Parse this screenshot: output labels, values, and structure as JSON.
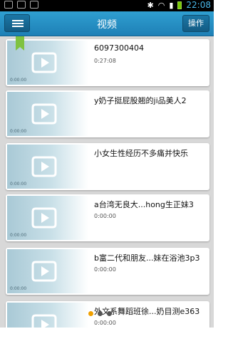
{
  "status_bar": {
    "time": "22:08"
  },
  "header": {
    "title": "视频",
    "action_label": "操作"
  },
  "videos": [
    {
      "title": "6097300404",
      "duration": "0:27:08",
      "thumb_time": "0:00:00"
    },
    {
      "title": "y奶子挺屁股翘的ji品美人2",
      "duration": "",
      "thumb_time": "0:00:00"
    },
    {
      "title": "小女生性经历不多痛并快乐",
      "duration": "",
      "thumb_time": "0:00:00"
    },
    {
      "title": "a台湾无良大...hong生正妹3",
      "duration": "0:00:00",
      "thumb_time": "0:00:00"
    },
    {
      "title": "b富二代和朋友...妹在浴池3p3",
      "duration": "0:00:00",
      "thumb_time": "0:00:00"
    },
    {
      "title": "外文系舞蹈班徐...奶目测e363",
      "duration": "0:00:00",
      "thumb_time": ""
    }
  ],
  "colors": {
    "header": "#2f9fd1",
    "bookmark": "#7fc241",
    "active_dot": "#f0a000"
  }
}
